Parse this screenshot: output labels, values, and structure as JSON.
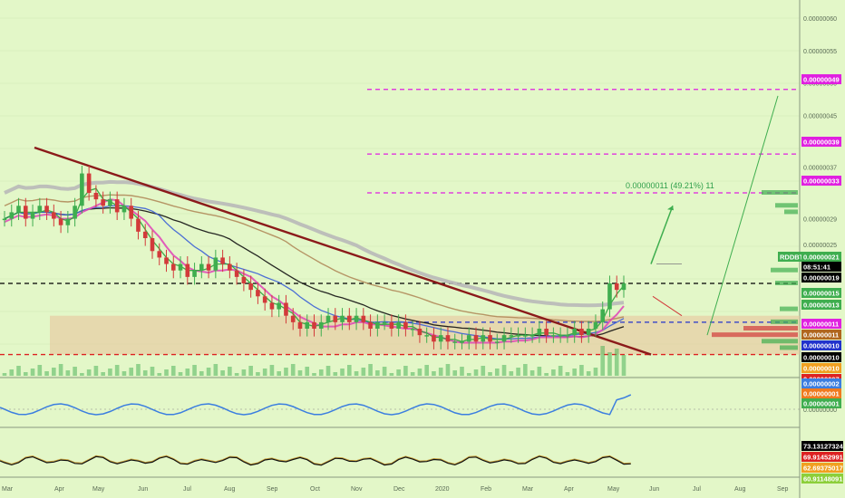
{
  "colors": {
    "background": "#e3f7c8",
    "grid": "#d2e8b4",
    "up": "#3fae4f",
    "down": "#d23a3a",
    "trendline": "#8b1a1a",
    "ma_gray": "#b8b8b8",
    "ma_brown": "#b08a5a",
    "ma_black": "#111111",
    "ma_blue": "#3b5fd6",
    "ma_pink": "#e04bb8",
    "ma_green": "#2aa43a",
    "magenta_level": "#e020e0",
    "red_level": "#dd2222",
    "blue_level": "#2233cc",
    "box_fill": "#e8c9a0",
    "oscillator_blue": "#3b7ee0",
    "rsi_line": "#111111",
    "rsi_band": "#c9a23c"
  },
  "chart_data": {
    "type": "candlestick",
    "symbol": "RDDBTC",
    "x_tick_labels": [
      "Mar",
      "Apr",
      "May",
      "Jun",
      "Jul",
      "Aug",
      "Sep",
      "Oct",
      "Nov",
      "Dec",
      "2020",
      "Feb",
      "Mar",
      "Apr",
      "May",
      "Jun",
      "Jul",
      "Aug",
      "Sep"
    ],
    "y_axis_labels": [
      "0.00000060",
      "0.00000055",
      "0.00000050",
      "0.00000045",
      "0.00000041",
      "0.00000037",
      "0.00000029",
      "0.00000025"
    ],
    "ylim": [
      5e-08,
      6.1e-07
    ],
    "grid": true,
    "candles": [
      {
        "c": 2.9e-07
      },
      {
        "c": 3e-07
      },
      {
        "c": 3.1e-07
      },
      {
        "c": 2.9e-07
      },
      {
        "c": 3e-07
      },
      {
        "c": 3.1e-07
      },
      {
        "c": 3e-07
      },
      {
        "c": 2.9e-07
      },
      {
        "c": 2.8e-07
      },
      {
        "c": 2.9e-07
      },
      {
        "c": 3.1e-07
      },
      {
        "c": 3.6e-07
      },
      {
        "c": 3.3e-07
      },
      {
        "c": 3.2e-07
      },
      {
        "c": 3.1e-07
      },
      {
        "c": 3.2e-07
      },
      {
        "c": 3e-07
      },
      {
        "c": 3.1e-07
      },
      {
        "c": 2.9e-07
      },
      {
        "c": 2.7e-07
      },
      {
        "c": 2.6e-07
      },
      {
        "c": 2.4e-07
      },
      {
        "c": 2.3e-07
      },
      {
        "c": 2.2e-07
      },
      {
        "c": 2.1e-07
      },
      {
        "c": 2.2e-07
      },
      {
        "c": 2e-07
      },
      {
        "c": 2.1e-07
      },
      {
        "c": 2.2e-07
      },
      {
        "c": 2.1e-07
      },
      {
        "c": 2.3e-07
      },
      {
        "c": 2.2e-07
      },
      {
        "c": 2.1e-07
      },
      {
        "c": 2e-07
      },
      {
        "c": 1.9e-07
      },
      {
        "c": 1.8e-07
      },
      {
        "c": 1.7e-07
      },
      {
        "c": 1.6e-07
      },
      {
        "c": 1.5e-07
      },
      {
        "c": 1.6e-07
      },
      {
        "c": 1.4e-07
      },
      {
        "c": 1.3e-07
      },
      {
        "c": 1.2e-07
      },
      {
        "c": 1.3e-07
      },
      {
        "c": 1.2e-07
      },
      {
        "c": 1.3e-07
      },
      {
        "c": 1.4e-07
      },
      {
        "c": 1.3e-07
      },
      {
        "c": 1.4e-07
      },
      {
        "c": 1.3e-07
      },
      {
        "c": 1.4e-07
      },
      {
        "c": 1.3e-07
      },
      {
        "c": 1.2e-07
      },
      {
        "c": 1.3e-07
      },
      {
        "c": 1.3e-07
      },
      {
        "c": 1.2e-07
      },
      {
        "c": 1.3e-07
      },
      {
        "c": 1.2e-07
      },
      {
        "c": 1.2e-07
      },
      {
        "c": 1.1e-07
      },
      {
        "c": 1.1e-07
      },
      {
        "c": 1e-07
      },
      {
        "c": 1.1e-07
      },
      {
        "c": 1e-07
      },
      {
        "c": 1e-07
      },
      {
        "c": 1e-07
      },
      {
        "c": 1.1e-07
      },
      {
        "c": 1e-07
      },
      {
        "c": 1.1e-07
      },
      {
        "c": 1e-07
      },
      {
        "c": 1e-07
      },
      {
        "c": 1.1e-07
      },
      {
        "c": 1.1e-07
      },
      {
        "c": 1.1e-07
      },
      {
        "c": 1.1e-07
      },
      {
        "c": 1.1e-07
      },
      {
        "c": 1.2e-07
      },
      {
        "c": 1.1e-07
      },
      {
        "c": 1.1e-07
      },
      {
        "c": 1.1e-07
      },
      {
        "c": 1.1e-07
      },
      {
        "c": 1.2e-07
      },
      {
        "c": 1.1e-07
      },
      {
        "c": 1.2e-07
      },
      {
        "c": 1.3e-07
      },
      {
        "c": 1.5e-07
      },
      {
        "c": 1.9e-07
      },
      {
        "c": 1.8e-07
      },
      {
        "c": 1.9e-07
      }
    ],
    "trendline": {
      "from": [
        0,
        4e-07
      ],
      "to": [
        1,
        8e-08
      ]
    },
    "moving_averages": [
      "gray",
      "brown",
      "black",
      "blue",
      "pink",
      "green"
    ],
    "horizontal_levels": [
      {
        "value": 4.9e-07,
        "color": "magenta",
        "style": "dashed"
      },
      {
        "value": 3.9e-07,
        "color": "magenta",
        "style": "dashed"
      },
      {
        "value": 3.3e-07,
        "color": "magenta",
        "style": "dashed"
      },
      {
        "value": 1.9e-07,
        "color": "black",
        "style": "dashed"
      },
      {
        "value": 1.3e-07,
        "color": "blue",
        "style": "dashed"
      },
      {
        "value": 8e-08,
        "color": "red",
        "style": "dashed"
      }
    ],
    "support_zone": [
      8e-08,
      1.4e-07
    ],
    "measure_annotation": "0.00000011 (49.21%) 11",
    "price_tags": [
      {
        "label": "0.00000049",
        "color": "#e020e0"
      },
      {
        "label": "0.00000039",
        "color": "#e020e0"
      },
      {
        "label": "0.00000033",
        "color": "#e020e0"
      },
      {
        "label": "RDDBTC",
        "color": "#3fae4f"
      },
      {
        "label": "0.00000021",
        "color": "#3fae4f"
      },
      {
        "label": "08:51:41",
        "color": "#000000"
      },
      {
        "label": "0.00000019",
        "color": "#000000"
      },
      {
        "label": "0.00000015",
        "color": "#3fae4f"
      },
      {
        "label": "0.00000013",
        "color": "#2233cc"
      },
      {
        "label": "0.00000013",
        "color": "#3fae4f"
      },
      {
        "label": "0.00000011",
        "color": "#e020e0"
      },
      {
        "label": "0.00000011",
        "color": "#b0671e"
      },
      {
        "label": "0.00000010",
        "color": "#2233cc"
      },
      {
        "label": "0.00000010",
        "color": "#000000"
      },
      {
        "label": "0.00000010",
        "color": "#f0a020"
      },
      {
        "label": "0.00000007",
        "color": "#dd2222"
      },
      {
        "label": "0.00000002",
        "color": "#3b7ee0"
      },
      {
        "label": "0.00000001",
        "color": "#f07a1e"
      },
      {
        "label": "0.00000001",
        "color": "#3fae4f"
      }
    ],
    "rsi_tags": [
      {
        "label": "73.13127324",
        "color": "#000000"
      },
      {
        "label": "69.91452991",
        "color": "#dd2222"
      },
      {
        "label": "62.69375017",
        "color": "#f0a020"
      },
      {
        "label": "60.91148091",
        "color": "#8ccf3a"
      }
    ],
    "oscillator_axis_label": "0.00000000"
  }
}
